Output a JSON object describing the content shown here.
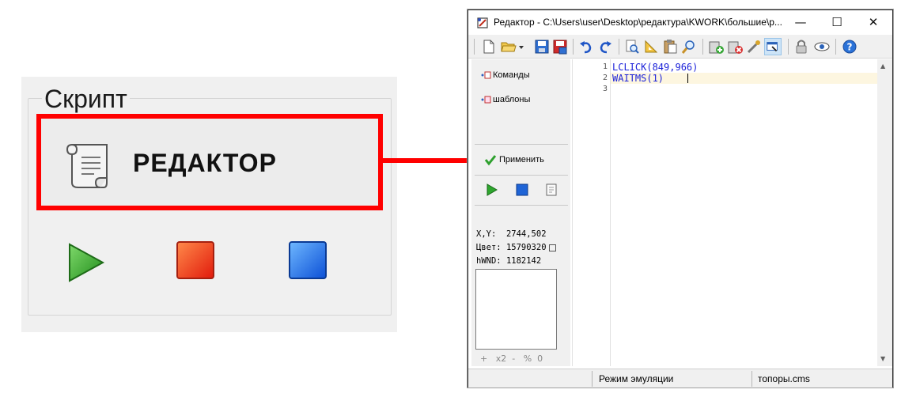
{
  "zoom": {
    "group_title": "Скрипт",
    "editor_button": "РЕДАКТОР"
  },
  "window": {
    "title": "Редактор - C:\\Users\\user\\Desktop\\редактура\\KWORK\\большие\\р...",
    "controls": {
      "minimize": "—",
      "maximize": "☐",
      "close": "✕"
    }
  },
  "toolbar": {
    "icons": [
      "new-file-icon",
      "open-folder-icon",
      "dropdown-arrow-icon",
      "save-icon",
      "save-all-icon",
      "undo-icon",
      "redo-icon",
      "find-icon",
      "ruler-icon",
      "paste-icon",
      "find-replace-icon",
      "add-item-icon",
      "remove-item-icon",
      "pipette-icon",
      "capture-window-icon",
      "lock-icon",
      "eye-icon",
      "help-icon"
    ]
  },
  "sidebar": {
    "commands": "Команды",
    "templates": "шаблоны",
    "apply": "Применить",
    "coords_label": "X,Y:",
    "coords_value": "2744,502",
    "color_label": "Цвет:",
    "color_value": "15790320",
    "hwnd_label": "hWND:",
    "hwnd_value": "1182142",
    "zoom_plus": "+",
    "zoom_x2": "x2",
    "zoom_minus": "-",
    "zoom_percent": "%",
    "zoom_zero": "0"
  },
  "editor": {
    "lines": [
      {
        "num": "1",
        "text": "LCLICK(849,966)"
      },
      {
        "num": "2",
        "text": "WAITMS(1)"
      },
      {
        "num": "3",
        "text": ""
      }
    ]
  },
  "status": {
    "mode": "Режим эмуляции",
    "file": "топоры.cms"
  },
  "colors": {
    "highlight": "#ff0000",
    "code_text": "#1c22d9",
    "current_line": "#fdf6e0"
  }
}
